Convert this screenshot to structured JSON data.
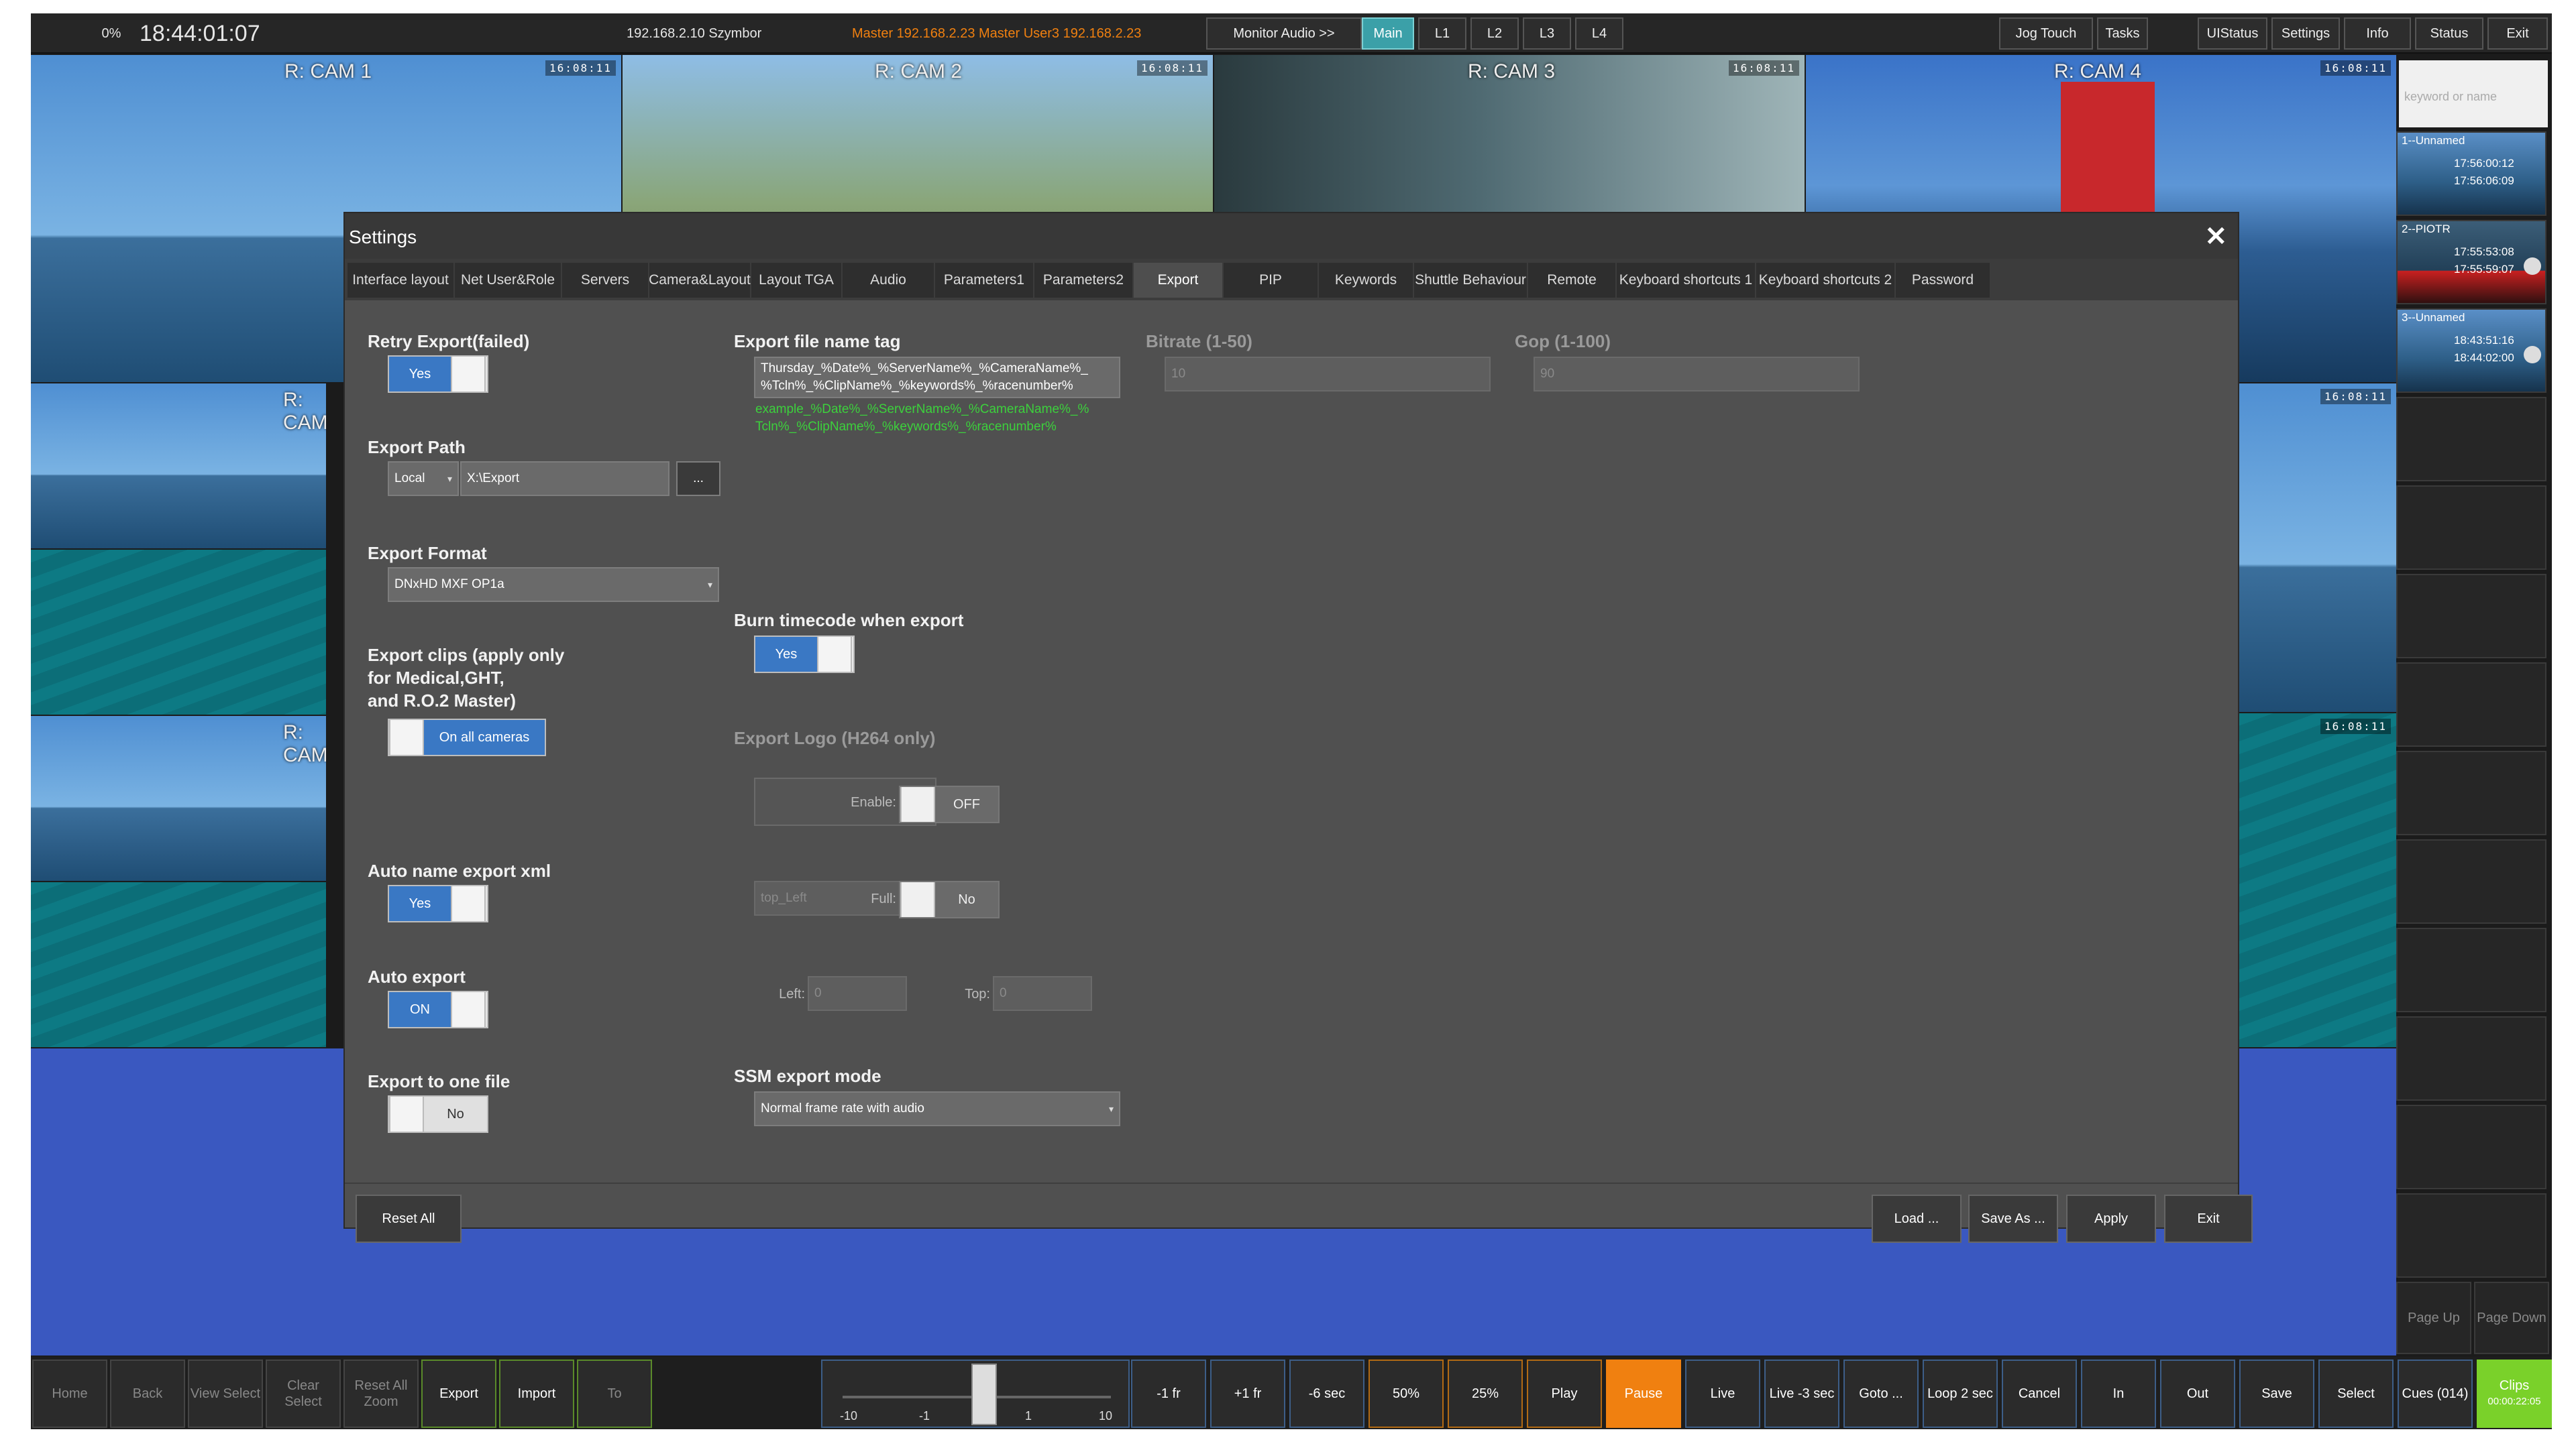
{
  "topbar": {
    "percent": "0%",
    "time": "18:44:01:07",
    "server": "192.168.2.10 Szymbor",
    "master_info": "Master 192.168.2.23  Master  User3  192.168.2.23",
    "monitor_audio": "Monitor Audio >>",
    "main": "Main",
    "l1": "L1",
    "l2": "L2",
    "l3": "L3",
    "l4": "L4",
    "jog_touch": "Jog Touch",
    "tasks": "Tasks",
    "ui_status": "UIStatus",
    "settings": "Settings",
    "info": "Info",
    "status": "Status",
    "exit": "Exit"
  },
  "cameras": {
    "cam1": "R: CAM 1",
    "cam2": "R: CAM 2",
    "cam3": "R: CAM 3",
    "cam4": "R: CAM 4",
    "cam_partial": "R: CAM",
    "timecode": "16:08:11"
  },
  "clips": {
    "search_placeholder": "keyword or name",
    "items": [
      {
        "name": "1--Unnamed",
        "in": "17:56:00:12",
        "out": "17:56:06:09"
      },
      {
        "name": "2--PIOTR",
        "in": "17:55:53:08",
        "out": "17:55:59:07"
      },
      {
        "name": "3--Unnamed",
        "in": "18:43:51:16",
        "out": "18:44:02:00"
      }
    ],
    "page_up": "Page Up",
    "page_down": "Page Down"
  },
  "dialog": {
    "title": "Settings",
    "close": "✕",
    "tabs": [
      "Interface layout",
      "Net User&Role",
      "Servers",
      "Camera&Layout",
      "Layout TGA",
      "Audio",
      "Parameters1",
      "Parameters2",
      "Export",
      "PIP",
      "Keywords",
      "Shuttle Behaviour",
      "Remote",
      "Keyboard shortcuts 1",
      "Keyboard shortcuts 2",
      "Password"
    ],
    "retry_export": {
      "label": "Retry Export(failed)",
      "value": "Yes"
    },
    "export_path": {
      "label": "Export Path",
      "location": "Local",
      "path": "X:\\Export",
      "browse": "..."
    },
    "export_format": {
      "label": "Export Format",
      "value": "DNxHD MXF OP1a"
    },
    "export_clips": {
      "label_1": "Export clips (apply only",
      "label_2": "for Medical,GHT,",
      "label_3": "and R.O.2 Master)",
      "value": "On all cameras"
    },
    "auto_name_xml": {
      "label": "Auto name export xml",
      "value": "Yes"
    },
    "auto_export": {
      "label": "Auto export",
      "value": "ON"
    },
    "export_one_file": {
      "label": "Export to one file",
      "value": "No"
    },
    "file_name_tag": {
      "label": "Export file name tag",
      "line1": "Thursday_%Date%_%ServerName%_%CameraName%_",
      "line2": "%Tcln%_%ClipName%_%keywords%_%racenumber%",
      "example1": "example_%Date%_%ServerName%_%CameraName%_%",
      "example2": "Tcln%_%ClipName%_%keywords%_%racenumber%"
    },
    "bitrate": {
      "label": "Bitrate (1-50)",
      "value": "10"
    },
    "gop": {
      "label": "Gop (1-100)",
      "value": "90"
    },
    "burn_tc": {
      "label": "Burn timecode when export",
      "value": "Yes"
    },
    "export_logo": {
      "label": "Export Logo (H264 only)",
      "enable_label": "Enable:",
      "enable_value": "OFF",
      "position": "top_Left",
      "full_label": "Full:",
      "full_value": "No",
      "left_label": "Left:",
      "left_value": "0",
      "top_label": "Top:",
      "top_value": "0"
    },
    "ssm": {
      "label": "SSM export mode",
      "value": "Normal frame rate with audio"
    },
    "reset_all": "Reset All",
    "load": "Load ...",
    "save_as": "Save As ...",
    "apply": "Apply",
    "exit": "Exit"
  },
  "bottombar": {
    "home": "Home",
    "back": "Back",
    "view_select": "View Select",
    "clear_select": "Clear Select",
    "reset_zoom": "Reset All Zoom",
    "export": "Export",
    "import": "Import",
    "to": "To",
    "jog_ticks": [
      "-10",
      "-1",
      "1",
      "10"
    ],
    "minus1fr": "-1 fr",
    "plus1fr": "+1 fr",
    "minus6sec": "-6 sec",
    "p50": "50%",
    "p25": "25%",
    "play": "Play",
    "pause": "Pause",
    "live": "Live",
    "live3": "Live -3 sec",
    "goto": "Goto ...",
    "loop": "Loop 2 sec",
    "cancel": "Cancel",
    "in": "In",
    "out": "Out",
    "save": "Save",
    "select": "Select",
    "cues": "Cues (014)",
    "clips": "Clips",
    "clips_tc": "00:00:22:05"
  }
}
